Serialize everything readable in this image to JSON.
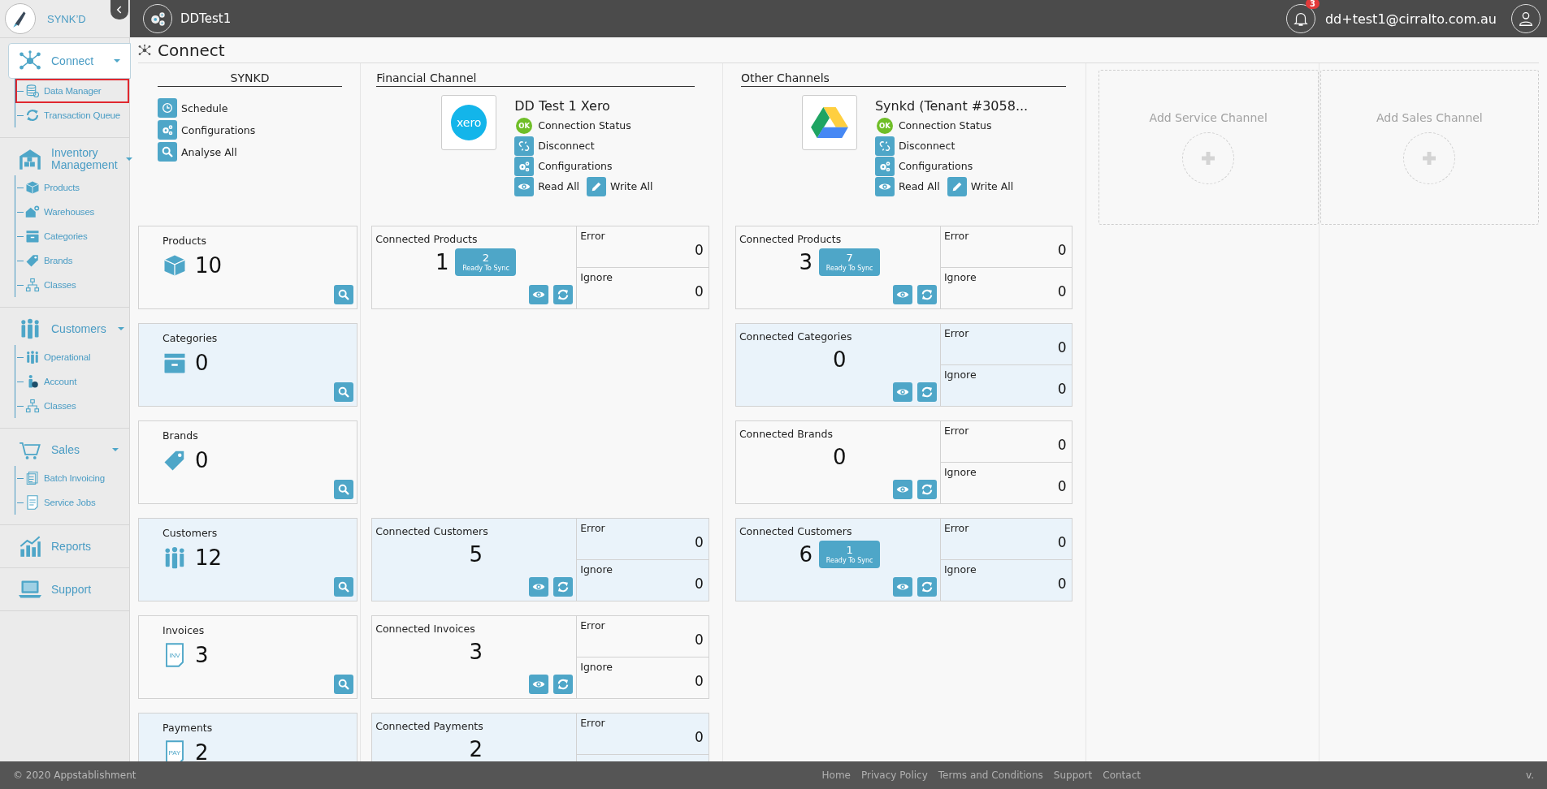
{
  "app": {
    "name": "SYNK’D"
  },
  "header": {
    "workspace": "DDTest1",
    "notifications": "3",
    "user": "dd+test1@cirralto.com.au"
  },
  "sidebar": {
    "groups": [
      {
        "label": "Connect",
        "selected": true,
        "children": [
          {
            "label": "Data Manager",
            "selected": true
          },
          {
            "label": "Transaction Queue",
            "selected": false
          }
        ]
      },
      {
        "label": "Inventory Management",
        "selected": false,
        "children": [
          {
            "label": "Products",
            "selected": false
          },
          {
            "label": "Warehouses",
            "selected": false
          },
          {
            "label": "Categories",
            "selected": false
          },
          {
            "label": "Brands",
            "selected": false
          },
          {
            "label": "Classes",
            "selected": false
          }
        ]
      },
      {
        "label": "Customers",
        "selected": false,
        "children": [
          {
            "label": "Operational",
            "selected": false
          },
          {
            "label": "Account",
            "selected": false
          },
          {
            "label": "Classes",
            "selected": false
          }
        ]
      },
      {
        "label": "Sales",
        "selected": false,
        "children": [
          {
            "label": "Batch Invoicing",
            "selected": false
          },
          {
            "label": "Service Jobs",
            "selected": false
          }
        ]
      },
      {
        "label": "Reports",
        "selected": false
      },
      {
        "label": "Support",
        "selected": false
      }
    ]
  },
  "page": {
    "title": "Connect"
  },
  "synkd": {
    "title": "SYNKD",
    "actions": [
      {
        "label": "Schedule"
      },
      {
        "label": "Configurations"
      },
      {
        "label": "Analyse All"
      }
    ],
    "cards": [
      {
        "label": "Products",
        "value": "10"
      },
      {
        "label": "Categories",
        "value": "0"
      },
      {
        "label": "Brands",
        "value": "0"
      },
      {
        "label": "Customers",
        "value": "12"
      },
      {
        "label": "Invoices",
        "value": "3",
        "icon_text": "INV"
      },
      {
        "label": "Payments",
        "value": "2",
        "icon_text": "PAY"
      }
    ]
  },
  "channels": [
    {
      "section": "Financial Channel",
      "name": "DD Test 1 Xero",
      "logo_text": "xero",
      "status": "OK",
      "status_label": "Connection Status",
      "action_lines": [
        [
          {
            "label": "Disconnect"
          }
        ],
        [
          {
            "label": "Configurations"
          }
        ],
        [
          {
            "label": "Read All"
          },
          {
            "label": "Write All"
          }
        ]
      ],
      "cards": {
        "products": {
          "label": "Connected Products",
          "value": "1",
          "ready": {
            "count": "2",
            "label": "Ready To Sync"
          },
          "error": {
            "label": "Error",
            "value": "0"
          },
          "ignore": {
            "label": "Ignore",
            "value": "0"
          }
        },
        "customers": {
          "label": "Connected Customers",
          "value": "5",
          "error": {
            "label": "Error",
            "value": "0"
          },
          "ignore": {
            "label": "Ignore",
            "value": "0"
          }
        },
        "invoices": {
          "label": "Connected Invoices",
          "value": "3",
          "error": {
            "label": "Error",
            "value": "0"
          },
          "ignore": {
            "label": "Ignore",
            "value": "0"
          }
        },
        "payments": {
          "label": "Connected Payments",
          "value": "2",
          "error": {
            "label": "Error",
            "value": "0"
          }
        }
      }
    },
    {
      "section": "Other Channels",
      "name": "Synkd (Tenant #3058...",
      "status": "OK",
      "status_label": "Connection Status",
      "action_lines": [
        [
          {
            "label": "Disconnect"
          }
        ],
        [
          {
            "label": "Configurations"
          }
        ],
        [
          {
            "label": "Read All"
          },
          {
            "label": "Write All"
          }
        ]
      ],
      "cards": {
        "products": {
          "label": "Connected Products",
          "value": "3",
          "ready": {
            "count": "7",
            "label": "Ready To Sync"
          },
          "error": {
            "label": "Error",
            "value": "0"
          },
          "ignore": {
            "label": "Ignore",
            "value": "0"
          }
        },
        "categories": {
          "label": "Connected Categories",
          "value": "0",
          "error": {
            "label": "Error",
            "value": "0"
          },
          "ignore": {
            "label": "Ignore",
            "value": "0"
          }
        },
        "brands": {
          "label": "Connected Brands",
          "value": "0",
          "error": {
            "label": "Error",
            "value": "0"
          },
          "ignore": {
            "label": "Ignore",
            "value": "0"
          }
        },
        "customers": {
          "label": "Connected Customers",
          "value": "6",
          "ready": {
            "count": "1",
            "label": "Ready To Sync"
          },
          "error": {
            "label": "Error",
            "value": "0"
          },
          "ignore": {
            "label": "Ignore",
            "value": "0"
          }
        }
      }
    }
  ],
  "add_channels": [
    {
      "label": "Add Service Channel"
    },
    {
      "label": "Add Sales Channel"
    }
  ],
  "footer": {
    "copyright": "© 2020 Appstablishment",
    "links": [
      "Home",
      "Privacy Policy",
      "Terms and Conditions",
      "Support",
      "Contact"
    ],
    "version": "v."
  }
}
